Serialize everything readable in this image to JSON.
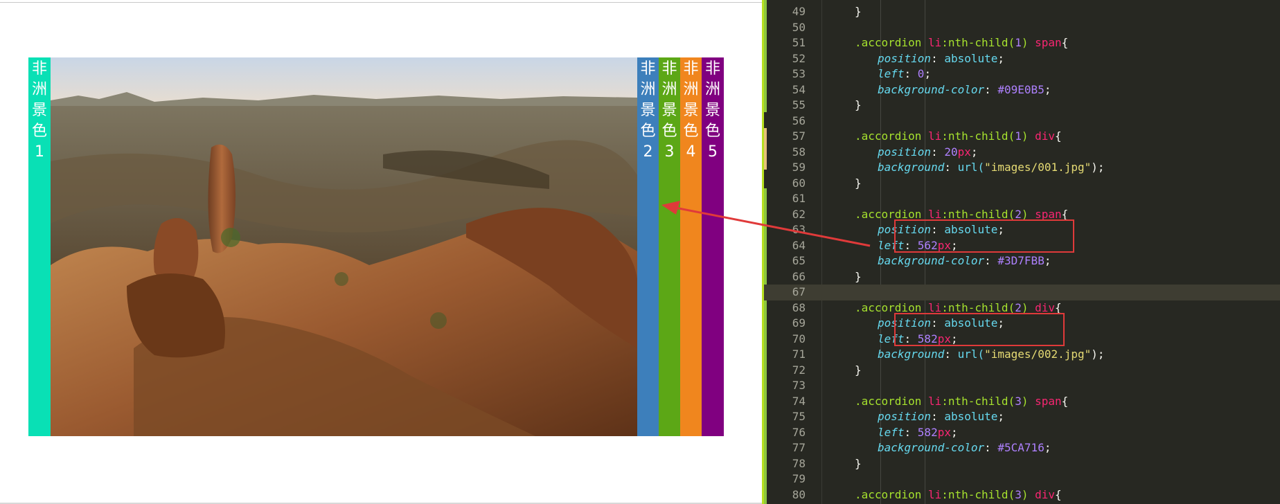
{
  "accordion": {
    "tabs": [
      {
        "chars": [
          "非",
          "洲",
          "景",
          "色",
          "1"
        ],
        "color": "#09E0B5"
      },
      {
        "chars": [
          "非",
          "洲",
          "景",
          "色",
          "2"
        ],
        "color": "#3D7FBB"
      },
      {
        "chars": [
          "非",
          "洲",
          "景",
          "色",
          "3"
        ],
        "color": "#5CA716"
      },
      {
        "chars": [
          "非",
          "洲",
          "景",
          "色",
          "4"
        ],
        "color": "#F0861E"
      },
      {
        "chars": [
          "非",
          "洲",
          "景",
          "色",
          "5"
        ],
        "color": "#800080"
      }
    ]
  },
  "editor": {
    "lines": [
      {
        "n": "49",
        "code": "}"
      },
      {
        "n": "50",
        "code": ""
      },
      {
        "n": "51",
        "sel": ".accordion ",
        "tag": "li",
        "sel2": ":nth-child(",
        "num": "1",
        "sel3": ") ",
        "tag2": "span",
        "brace": "{"
      },
      {
        "n": "52",
        "prop": "position",
        "val": "absolute"
      },
      {
        "n": "53",
        "prop": "left",
        "num": "0"
      },
      {
        "n": "54",
        "prop": "background-color",
        "num": "#09E0B5"
      },
      {
        "n": "55",
        "code": "}"
      },
      {
        "n": "56",
        "code": ""
      },
      {
        "n": "57",
        "sel": ".accordion ",
        "tag": "li",
        "sel2": ":nth-child(",
        "num": "1",
        "sel3": ") ",
        "tag2": "div",
        "brace": "{"
      },
      {
        "n": "58",
        "prop": "position",
        "num": "20",
        "unit": "px"
      },
      {
        "n": "59",
        "prop": "background",
        "fn": "url(",
        "str": "\"images/001.jpg\"",
        "fn2": ")"
      },
      {
        "n": "60",
        "code": "}"
      },
      {
        "n": "61",
        "code": ""
      },
      {
        "n": "62",
        "sel": ".accordion ",
        "tag": "li",
        "sel2": ":nth-child(",
        "num": "2",
        "sel3": ") ",
        "tag2": "span",
        "brace": "{"
      },
      {
        "n": "63",
        "prop": "position",
        "val": "absolute"
      },
      {
        "n": "64",
        "prop": "left",
        "num": "562",
        "unit": "px"
      },
      {
        "n": "65",
        "prop": "background-color",
        "num": "#3D7FBB"
      },
      {
        "n": "66",
        "code": "}"
      },
      {
        "n": "67",
        "code": "",
        "current": true
      },
      {
        "n": "68",
        "sel": ".accordion ",
        "tag": "li",
        "sel2": ":nth-child(",
        "num": "2",
        "sel3": ") ",
        "tag2": "div",
        "brace": "{"
      },
      {
        "n": "69",
        "prop": "position",
        "val": "absolute"
      },
      {
        "n": "70",
        "prop": "left",
        "num": "582",
        "unit": "px"
      },
      {
        "n": "71",
        "prop": "background",
        "fn": "url(",
        "str": "\"images/002.jpg\"",
        "fn2": ")"
      },
      {
        "n": "72",
        "code": "}"
      },
      {
        "n": "73",
        "code": ""
      },
      {
        "n": "74",
        "sel": ".accordion ",
        "tag": "li",
        "sel2": ":nth-child(",
        "num": "3",
        "sel3": ") ",
        "tag2": "span",
        "brace": "{"
      },
      {
        "n": "75",
        "prop": "position",
        "val": "absolute"
      },
      {
        "n": "76",
        "prop": "left",
        "num": "582",
        "unit": "px"
      },
      {
        "n": "77",
        "prop": "background-color",
        "num": "#5CA716"
      },
      {
        "n": "78",
        "code": "}"
      },
      {
        "n": "79",
        "code": ""
      },
      {
        "n": "80",
        "sel": ".accordion ",
        "tag": "li",
        "sel2": ":nth-child(",
        "num": "3",
        "sel3": ") ",
        "tag2": "div",
        "brace": "{"
      }
    ]
  },
  "colors": {
    "editor_bg": "#272822",
    "highlight_box": "#e03a3a",
    "arrow": "#e03a3a"
  }
}
